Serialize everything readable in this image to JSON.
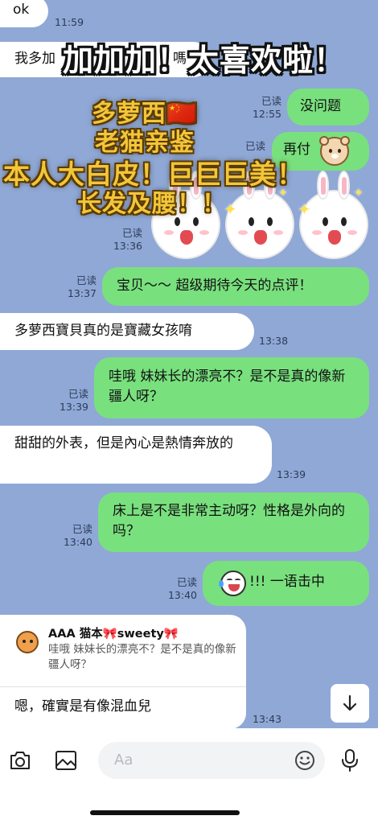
{
  "messages": [
    {
      "side": "left",
      "text": "ok",
      "time": "11:59"
    },
    {
      "side": "left",
      "text": "我多加",
      "suffix": "嗎",
      "time": "12:5"
    },
    {
      "side": "right",
      "text": "没问题",
      "read": "已读",
      "time": "12:55"
    },
    {
      "side": "right",
      "text": "再付",
      "read": "已读",
      "time": ""
    },
    {
      "side": "right",
      "text": "",
      "read": "已读",
      "time": "13:36",
      "sticker": "bunny-stickers"
    },
    {
      "side": "right",
      "text": "宝贝～～ 超级期待今天的点评！",
      "read": "已读",
      "time": "13:37"
    },
    {
      "side": "left",
      "text": "多萝西寶貝真的是寶藏女孩唷",
      "time": "13:38"
    },
    {
      "side": "right",
      "text": "哇哦 妹妹长的漂亮不？是不是真的像新疆人呀？",
      "read": "已读",
      "time": "13:39"
    },
    {
      "side": "left",
      "text": "甜甜的外表，但是內心是熱情奔放的",
      "time": "13:39"
    },
    {
      "side": "right",
      "text": "床上是不是非常主动呀？性格是外向的吗？",
      "read": "已读",
      "time": "13:40"
    },
    {
      "side": "right",
      "text": "!!! 一语击中",
      "read": "已读",
      "time": "13:40",
      "icon": "laughing-emoji-icon"
    },
    {
      "side": "left",
      "reply_name": "AAA 猫本🎀sweety🎀",
      "reply_quote": "哇哦 妹妹长的漂亮不？是不是真的像新疆人呀？",
      "text": "嗯，確實是有像混血兒",
      "time": "13:43"
    }
  ],
  "overlay": {
    "line1": "加加加！太喜欢啦！",
    "line2": "多萝西🇨🇳",
    "line3": "老猫亲鉴",
    "line4": "本人大白皮！巨巨巨美！",
    "line5": "长发及腰！！"
  },
  "input": {
    "placeholder": "Aa"
  },
  "colors": {
    "chat_bg": "#8fa8d6",
    "outgoing": "#79e07e",
    "incoming": "#ffffff"
  }
}
